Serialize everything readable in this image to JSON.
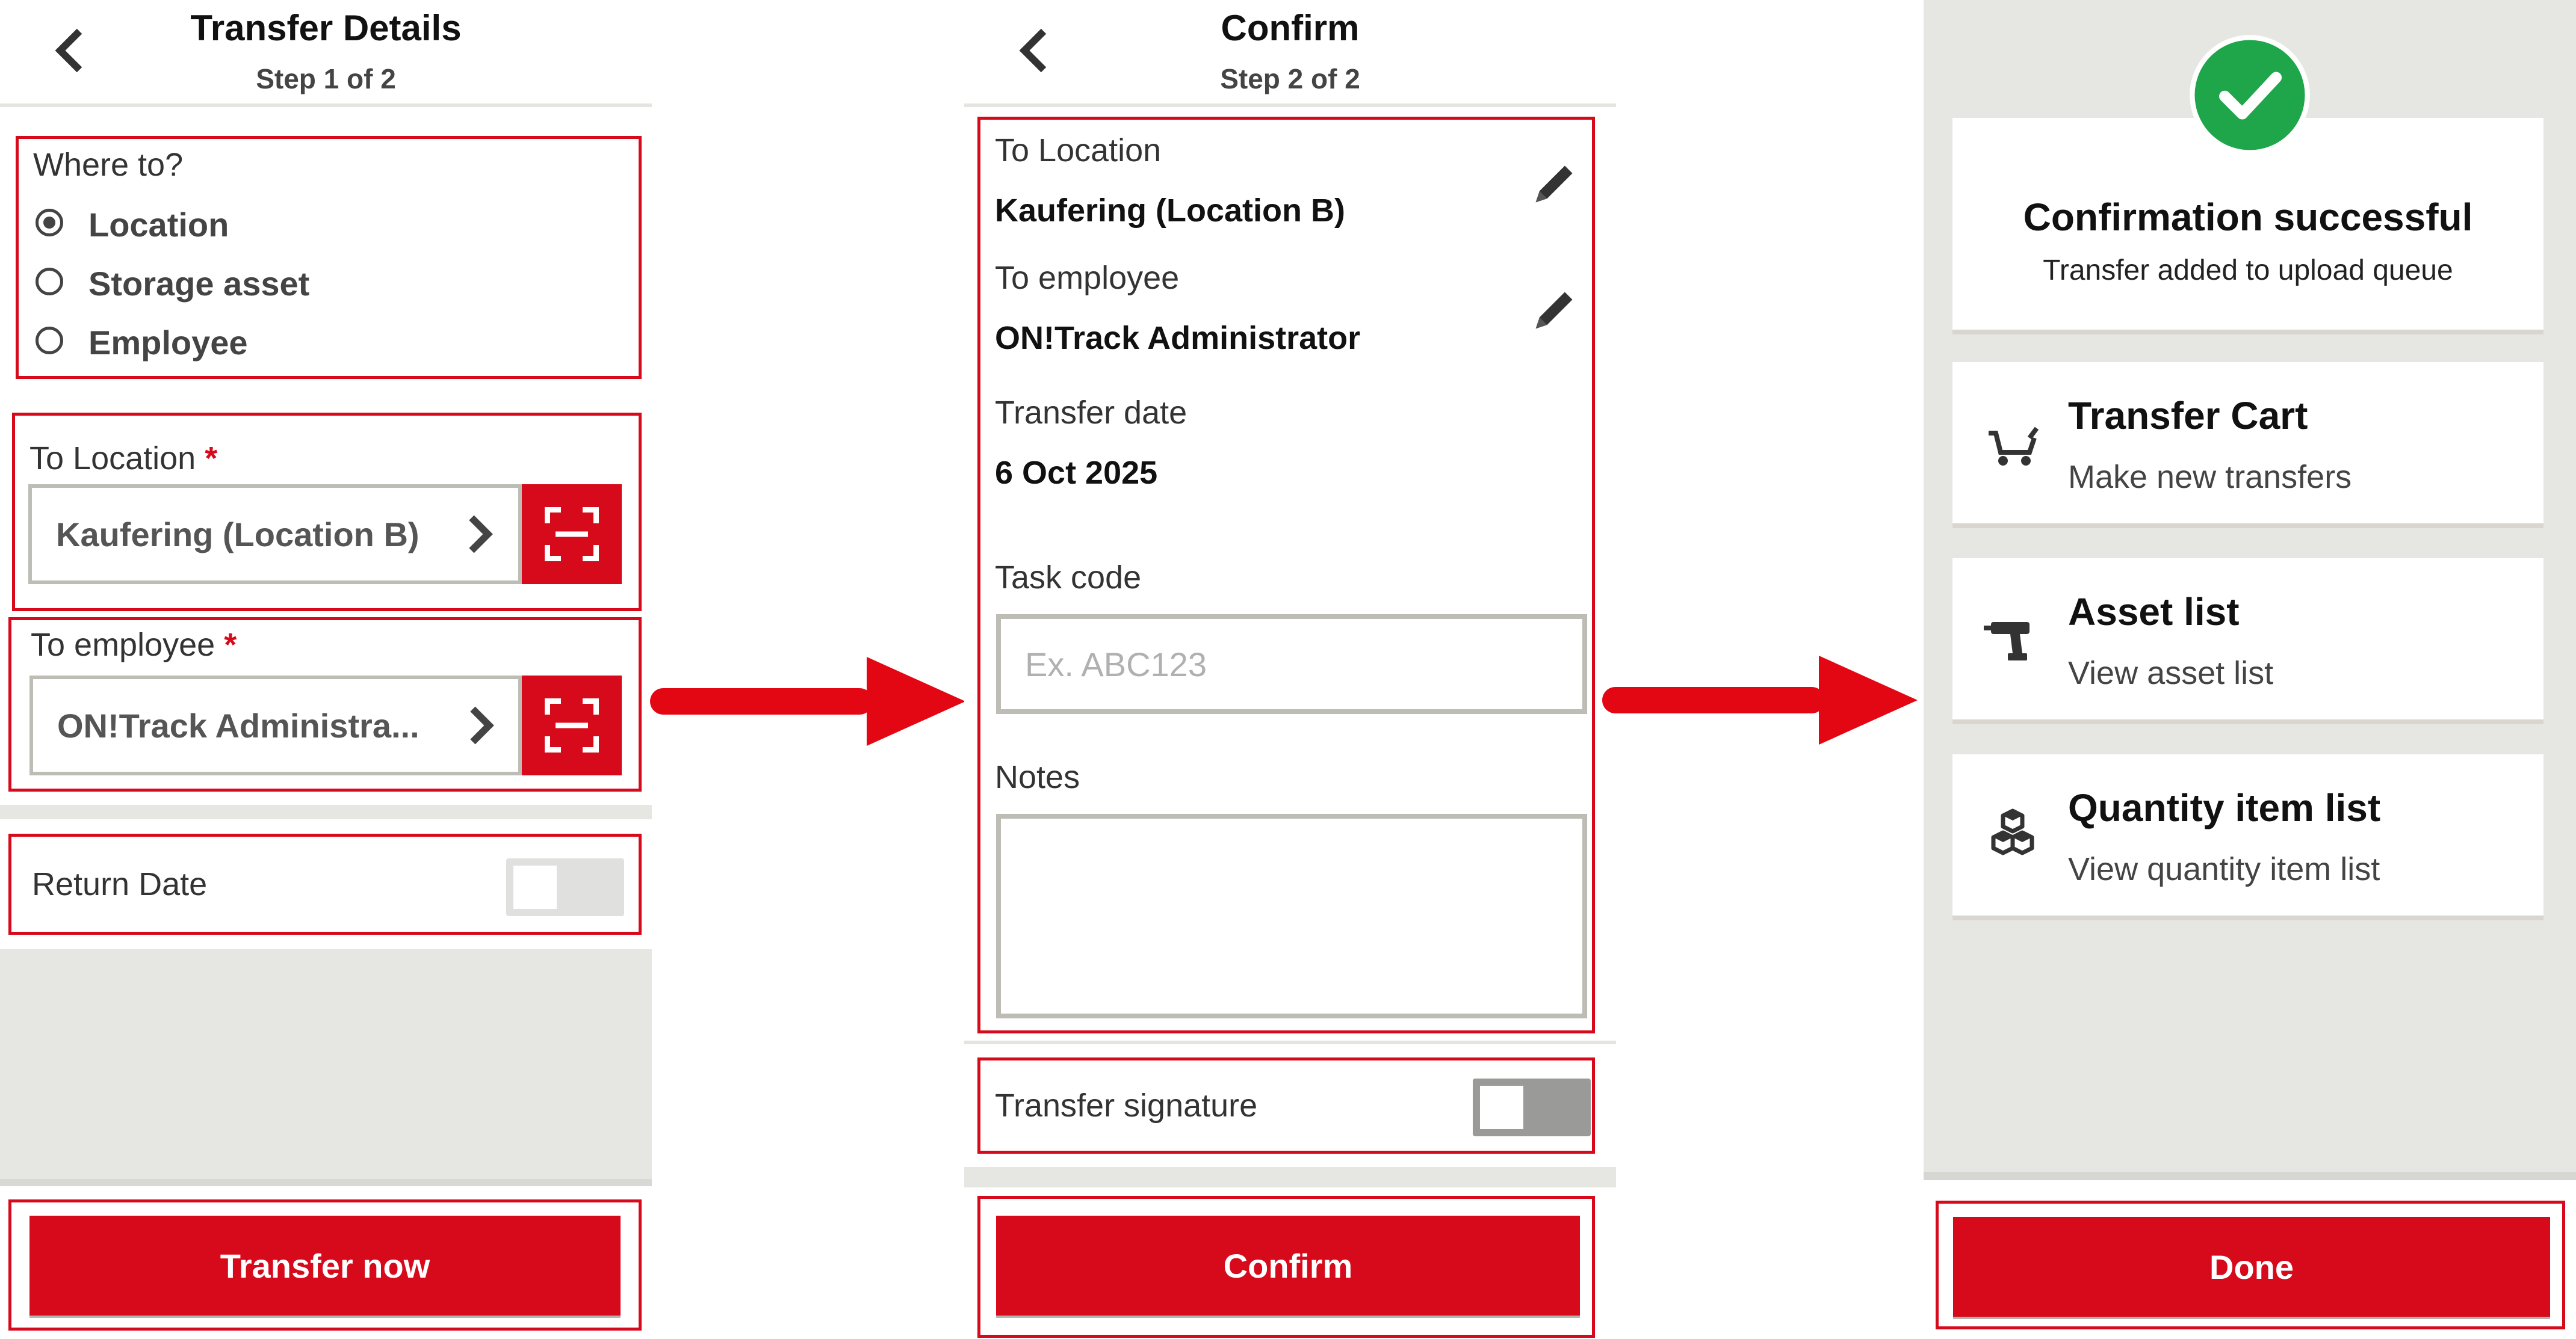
{
  "screen1": {
    "title": "Transfer Details",
    "step": "Step 1 of 2",
    "where_to": {
      "label": "Where to?",
      "options": [
        "Location",
        "Storage asset",
        "Employee"
      ],
      "selected": "Location"
    },
    "to_location": {
      "label": "To Location",
      "required_mark": "*",
      "value": "Kaufering (Location B)"
    },
    "to_employee": {
      "label": "To employee",
      "required_mark": "*",
      "value": "ON!Track Administra..."
    },
    "return_date": {
      "label": "Return Date",
      "enabled": false
    },
    "primary_button": "Transfer now"
  },
  "screen2": {
    "title": "Confirm",
    "step": "Step 2 of 2",
    "to_location": {
      "label": "To Location",
      "value": "Kaufering (Location B)"
    },
    "to_employee": {
      "label": "To employee",
      "value": "ON!Track Administrator"
    },
    "transfer_date": {
      "label": "Transfer date",
      "value": "6 Oct 2025"
    },
    "task_code": {
      "label": "Task code",
      "placeholder": "Ex. ABC123"
    },
    "notes": {
      "label": "Notes",
      "value": ""
    },
    "transfer_signature": {
      "label": "Transfer signature",
      "enabled": false
    },
    "primary_button": "Confirm"
  },
  "screen3": {
    "confirmation": {
      "title": "Confirmation successful",
      "subtitle": "Transfer added to upload queue"
    },
    "cards": [
      {
        "icon": "cart-icon",
        "title": "Transfer Cart",
        "subtitle": "Make new transfers"
      },
      {
        "icon": "drill-icon",
        "title": "Asset list",
        "subtitle": "View asset list"
      },
      {
        "icon": "boxes-icon",
        "title": "Quantity item list",
        "subtitle": "View quantity item list"
      }
    ],
    "primary_button": "Done"
  },
  "colors": {
    "accent": "#d60a1b",
    "success": "#1fa64a",
    "panel_grey": "#e6e6e3",
    "border_grey": "#bdbdb6"
  }
}
